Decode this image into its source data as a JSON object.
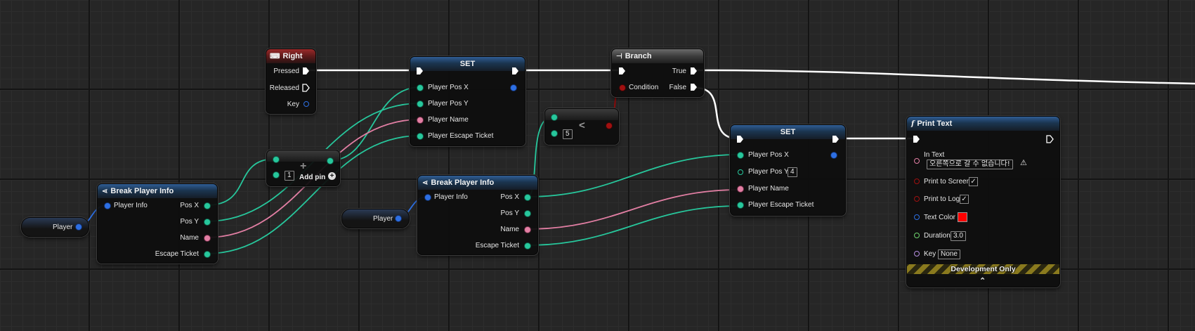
{
  "colors": {
    "exec": "#ffffff",
    "teal": "#27c79c",
    "pink": "#e37fa4",
    "blue": "#2d6fe3",
    "red": "#a01010",
    "text_color_swatch": "#ff0000"
  },
  "var_player_1": {
    "label": "Player"
  },
  "var_player_2": {
    "label": "Player"
  },
  "break_node_1": {
    "title": "Break Player Info",
    "icon": "break-struct-icon",
    "input_label": "Player Info",
    "outputs": [
      "Pos X",
      "Pos Y",
      "Name",
      "Escape Ticket"
    ]
  },
  "break_node_2": {
    "title": "Break Player Info",
    "icon": "break-struct-icon",
    "input_label": "Player Info",
    "outputs": [
      "Pos X",
      "Pos Y",
      "Name",
      "Escape Ticket"
    ]
  },
  "key_node": {
    "title": "Right",
    "icon": "keyboard-icon",
    "outputs": [
      "Pressed",
      "Released",
      "Key"
    ]
  },
  "add_node": {
    "value": "1",
    "add_pin_label": "Add pin",
    "symbol": "+"
  },
  "less_node": {
    "value": "5",
    "symbol": "<"
  },
  "set_node_1": {
    "title": "SET",
    "inputs": [
      "Player Pos X",
      "Player Pos Y",
      "Player Name",
      "Player Escape Ticket"
    ]
  },
  "set_node_2": {
    "title": "SET",
    "inputs": [
      "Player Pos X",
      "Player Pos Y",
      "Player Name",
      "Player Escape Ticket"
    ],
    "pos_y_value": "4"
  },
  "branch_node": {
    "title": "Branch",
    "icon": "branch-icon",
    "condition_label": "Condition",
    "true_label": "True",
    "false_label": "False"
  },
  "print_node": {
    "title": "Print Text",
    "icon": "function-icon",
    "in_text_label": "In Text",
    "in_text_value": "오른쪽으로 갈 수 없습니다!",
    "print_to_screen_label": "Print to Screen",
    "print_to_screen_checked": true,
    "print_to_log_label": "Print to Log",
    "print_to_log_checked": true,
    "text_color_label": "Text Color",
    "duration_label": "Duration",
    "duration_value": "3.0",
    "key_label": "Key",
    "key_value": "None",
    "footer_label": "Development Only",
    "check_glyph": "✓",
    "warning_glyph": "⚠",
    "expand_glyph": "⌃"
  }
}
